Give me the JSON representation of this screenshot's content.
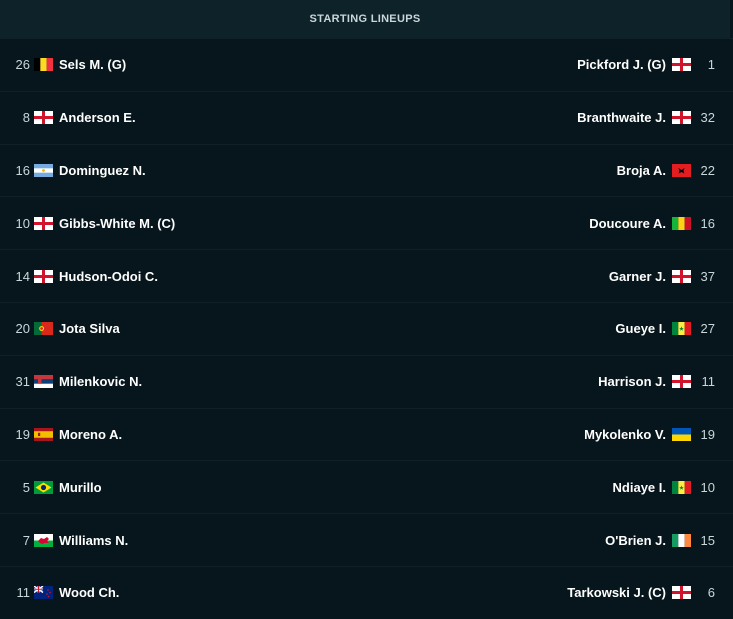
{
  "header": {
    "title": "STARTING LINEUPS"
  },
  "home": [
    {
      "number": "26",
      "name": "Sels M. (G)",
      "flag": "belgium-flag"
    },
    {
      "number": "8",
      "name": "Anderson E.",
      "flag": "england-flag"
    },
    {
      "number": "16",
      "name": "Dominguez N.",
      "flag": "argentina-flag"
    },
    {
      "number": "10",
      "name": "Gibbs-White M. (C)",
      "flag": "england-flag"
    },
    {
      "number": "14",
      "name": "Hudson-Odoi C.",
      "flag": "england-flag"
    },
    {
      "number": "20",
      "name": "Jota Silva",
      "flag": "portugal-flag"
    },
    {
      "number": "31",
      "name": "Milenkovic N.",
      "flag": "serbia-flag"
    },
    {
      "number": "19",
      "name": "Moreno A.",
      "flag": "spain-flag"
    },
    {
      "number": "5",
      "name": "Murillo",
      "flag": "brazil-flag"
    },
    {
      "number": "7",
      "name": "Williams N.",
      "flag": "wales-flag"
    },
    {
      "number": "11",
      "name": "Wood Ch.",
      "flag": "new-zealand-flag"
    }
  ],
  "away": [
    {
      "number": "1",
      "name": "Pickford J. (G)",
      "flag": "england-flag"
    },
    {
      "number": "32",
      "name": "Branthwaite J.",
      "flag": "england-flag"
    },
    {
      "number": "22",
      "name": "Broja A.",
      "flag": "albania-flag"
    },
    {
      "number": "16",
      "name": "Doucoure A.",
      "flag": "mali-flag"
    },
    {
      "number": "37",
      "name": "Garner J.",
      "flag": "england-flag"
    },
    {
      "number": "27",
      "name": "Gueye I.",
      "flag": "senegal-flag"
    },
    {
      "number": "11",
      "name": "Harrison J.",
      "flag": "england-flag"
    },
    {
      "number": "19",
      "name": "Mykolenko V.",
      "flag": "ukraine-flag"
    },
    {
      "number": "10",
      "name": "Ndiaye I.",
      "flag": "senegal-flag"
    },
    {
      "number": "15",
      "name": "O'Brien J.",
      "flag": "ireland-flag"
    },
    {
      "number": "6",
      "name": "Tarkowski J. (C)",
      "flag": "england-flag"
    }
  ]
}
